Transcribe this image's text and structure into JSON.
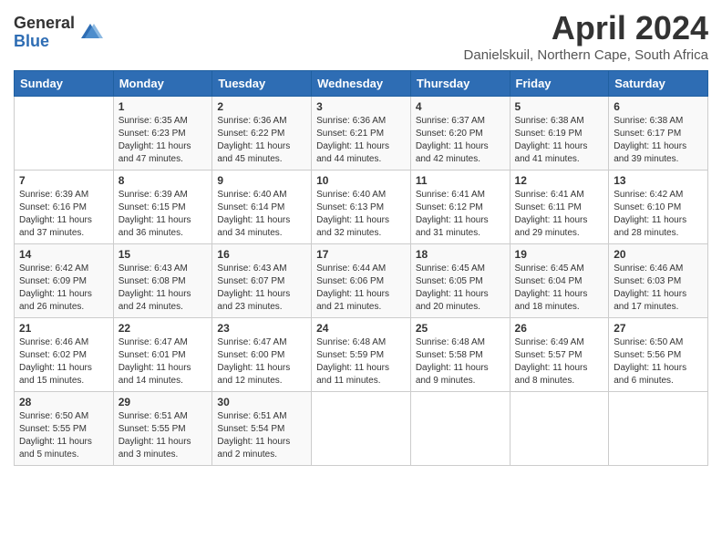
{
  "logo": {
    "general": "General",
    "blue": "Blue"
  },
  "title": "April 2024",
  "subtitle": "Danielskuil, Northern Cape, South Africa",
  "headers": [
    "Sunday",
    "Monday",
    "Tuesday",
    "Wednesday",
    "Thursday",
    "Friday",
    "Saturday"
  ],
  "weeks": [
    [
      {
        "day": "",
        "info": ""
      },
      {
        "day": "1",
        "info": "Sunrise: 6:35 AM\nSunset: 6:23 PM\nDaylight: 11 hours\nand 47 minutes."
      },
      {
        "day": "2",
        "info": "Sunrise: 6:36 AM\nSunset: 6:22 PM\nDaylight: 11 hours\nand 45 minutes."
      },
      {
        "day": "3",
        "info": "Sunrise: 6:36 AM\nSunset: 6:21 PM\nDaylight: 11 hours\nand 44 minutes."
      },
      {
        "day": "4",
        "info": "Sunrise: 6:37 AM\nSunset: 6:20 PM\nDaylight: 11 hours\nand 42 minutes."
      },
      {
        "day": "5",
        "info": "Sunrise: 6:38 AM\nSunset: 6:19 PM\nDaylight: 11 hours\nand 41 minutes."
      },
      {
        "day": "6",
        "info": "Sunrise: 6:38 AM\nSunset: 6:17 PM\nDaylight: 11 hours\nand 39 minutes."
      }
    ],
    [
      {
        "day": "7",
        "info": "Sunrise: 6:39 AM\nSunset: 6:16 PM\nDaylight: 11 hours\nand 37 minutes."
      },
      {
        "day": "8",
        "info": "Sunrise: 6:39 AM\nSunset: 6:15 PM\nDaylight: 11 hours\nand 36 minutes."
      },
      {
        "day": "9",
        "info": "Sunrise: 6:40 AM\nSunset: 6:14 PM\nDaylight: 11 hours\nand 34 minutes."
      },
      {
        "day": "10",
        "info": "Sunrise: 6:40 AM\nSunset: 6:13 PM\nDaylight: 11 hours\nand 32 minutes."
      },
      {
        "day": "11",
        "info": "Sunrise: 6:41 AM\nSunset: 6:12 PM\nDaylight: 11 hours\nand 31 minutes."
      },
      {
        "day": "12",
        "info": "Sunrise: 6:41 AM\nSunset: 6:11 PM\nDaylight: 11 hours\nand 29 minutes."
      },
      {
        "day": "13",
        "info": "Sunrise: 6:42 AM\nSunset: 6:10 PM\nDaylight: 11 hours\nand 28 minutes."
      }
    ],
    [
      {
        "day": "14",
        "info": "Sunrise: 6:42 AM\nSunset: 6:09 PM\nDaylight: 11 hours\nand 26 minutes."
      },
      {
        "day": "15",
        "info": "Sunrise: 6:43 AM\nSunset: 6:08 PM\nDaylight: 11 hours\nand 24 minutes."
      },
      {
        "day": "16",
        "info": "Sunrise: 6:43 AM\nSunset: 6:07 PM\nDaylight: 11 hours\nand 23 minutes."
      },
      {
        "day": "17",
        "info": "Sunrise: 6:44 AM\nSunset: 6:06 PM\nDaylight: 11 hours\nand 21 minutes."
      },
      {
        "day": "18",
        "info": "Sunrise: 6:45 AM\nSunset: 6:05 PM\nDaylight: 11 hours\nand 20 minutes."
      },
      {
        "day": "19",
        "info": "Sunrise: 6:45 AM\nSunset: 6:04 PM\nDaylight: 11 hours\nand 18 minutes."
      },
      {
        "day": "20",
        "info": "Sunrise: 6:46 AM\nSunset: 6:03 PM\nDaylight: 11 hours\nand 17 minutes."
      }
    ],
    [
      {
        "day": "21",
        "info": "Sunrise: 6:46 AM\nSunset: 6:02 PM\nDaylight: 11 hours\nand 15 minutes."
      },
      {
        "day": "22",
        "info": "Sunrise: 6:47 AM\nSunset: 6:01 PM\nDaylight: 11 hours\nand 14 minutes."
      },
      {
        "day": "23",
        "info": "Sunrise: 6:47 AM\nSunset: 6:00 PM\nDaylight: 11 hours\nand 12 minutes."
      },
      {
        "day": "24",
        "info": "Sunrise: 6:48 AM\nSunset: 5:59 PM\nDaylight: 11 hours\nand 11 minutes."
      },
      {
        "day": "25",
        "info": "Sunrise: 6:48 AM\nSunset: 5:58 PM\nDaylight: 11 hours\nand 9 minutes."
      },
      {
        "day": "26",
        "info": "Sunrise: 6:49 AM\nSunset: 5:57 PM\nDaylight: 11 hours\nand 8 minutes."
      },
      {
        "day": "27",
        "info": "Sunrise: 6:50 AM\nSunset: 5:56 PM\nDaylight: 11 hours\nand 6 minutes."
      }
    ],
    [
      {
        "day": "28",
        "info": "Sunrise: 6:50 AM\nSunset: 5:55 PM\nDaylight: 11 hours\nand 5 minutes."
      },
      {
        "day": "29",
        "info": "Sunrise: 6:51 AM\nSunset: 5:55 PM\nDaylight: 11 hours\nand 3 minutes."
      },
      {
        "day": "30",
        "info": "Sunrise: 6:51 AM\nSunset: 5:54 PM\nDaylight: 11 hours\nand 2 minutes."
      },
      {
        "day": "",
        "info": ""
      },
      {
        "day": "",
        "info": ""
      },
      {
        "day": "",
        "info": ""
      },
      {
        "day": "",
        "info": ""
      }
    ]
  ]
}
